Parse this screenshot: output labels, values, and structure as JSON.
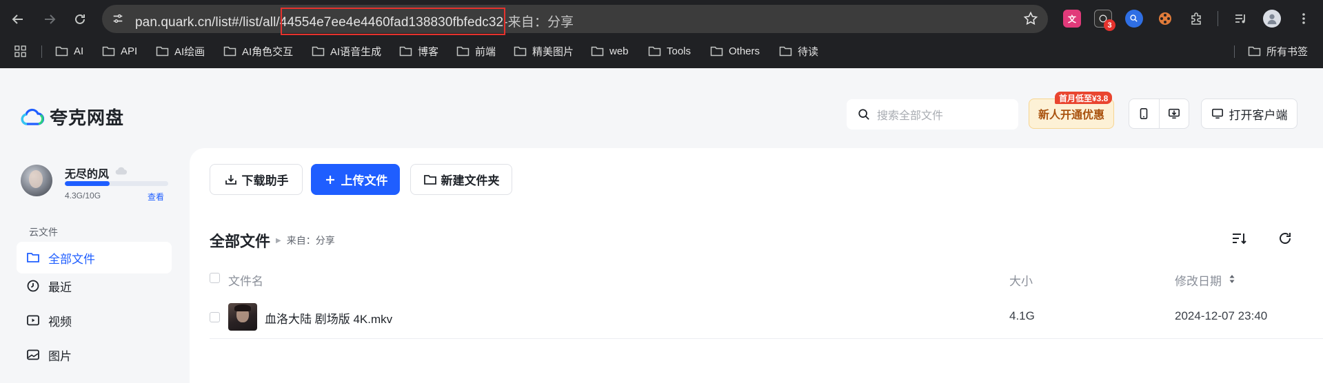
{
  "browser": {
    "url_host": "pan.quark.cn/list#/list/all/",
    "url_id": "44554e7ee4e4460fad138830fbfedc32",
    "url_tail": "-来自：分享",
    "extension_badge": "3",
    "bookmarks": [
      "AI",
      "API",
      "AI绘画",
      "AI角色交互",
      "AI语音生成",
      "博客",
      "前端",
      "精美图片",
      "web",
      "Tools",
      "Others",
      "待读"
    ],
    "all_bookmarks": "所有书签"
  },
  "header": {
    "logo_text": "夸克网盘",
    "search_placeholder": "搜索全部文件",
    "promo_label": "新人开通优惠",
    "promo_tag": "首月低至¥3.8",
    "client_label": "打开客户端"
  },
  "user": {
    "name": "无尽的风",
    "quota_text": "4.3G/10G",
    "quota_fraction": 0.43,
    "view_link": "查看"
  },
  "sidebar": {
    "section": "云文件",
    "items": [
      {
        "label": "全部文件",
        "icon": "folder-icon",
        "active": true
      },
      {
        "label": "最近",
        "icon": "clock-icon",
        "active": false
      },
      {
        "label": "视频",
        "icon": "video-icon",
        "active": false
      },
      {
        "label": "图片",
        "icon": "image-icon",
        "active": false
      }
    ]
  },
  "toolbar": {
    "download_label": "下载助手",
    "upload_label": "上传文件",
    "newfolder_label": "新建文件夹"
  },
  "breadcrumb": {
    "main": "全部文件",
    "sub": "来自：分享"
  },
  "table": {
    "columns": {
      "name": "文件名",
      "size": "大小",
      "modified": "修改日期"
    },
    "rows": [
      {
        "name": "血洛大陆 剧场版 4K.mkv",
        "size": "4.1G",
        "modified": "2024-12-07 23:40"
      }
    ]
  },
  "colors": {
    "accent": "#1f5eff",
    "highlight_box": "#e5322d",
    "promo_text": "#a9520e"
  }
}
